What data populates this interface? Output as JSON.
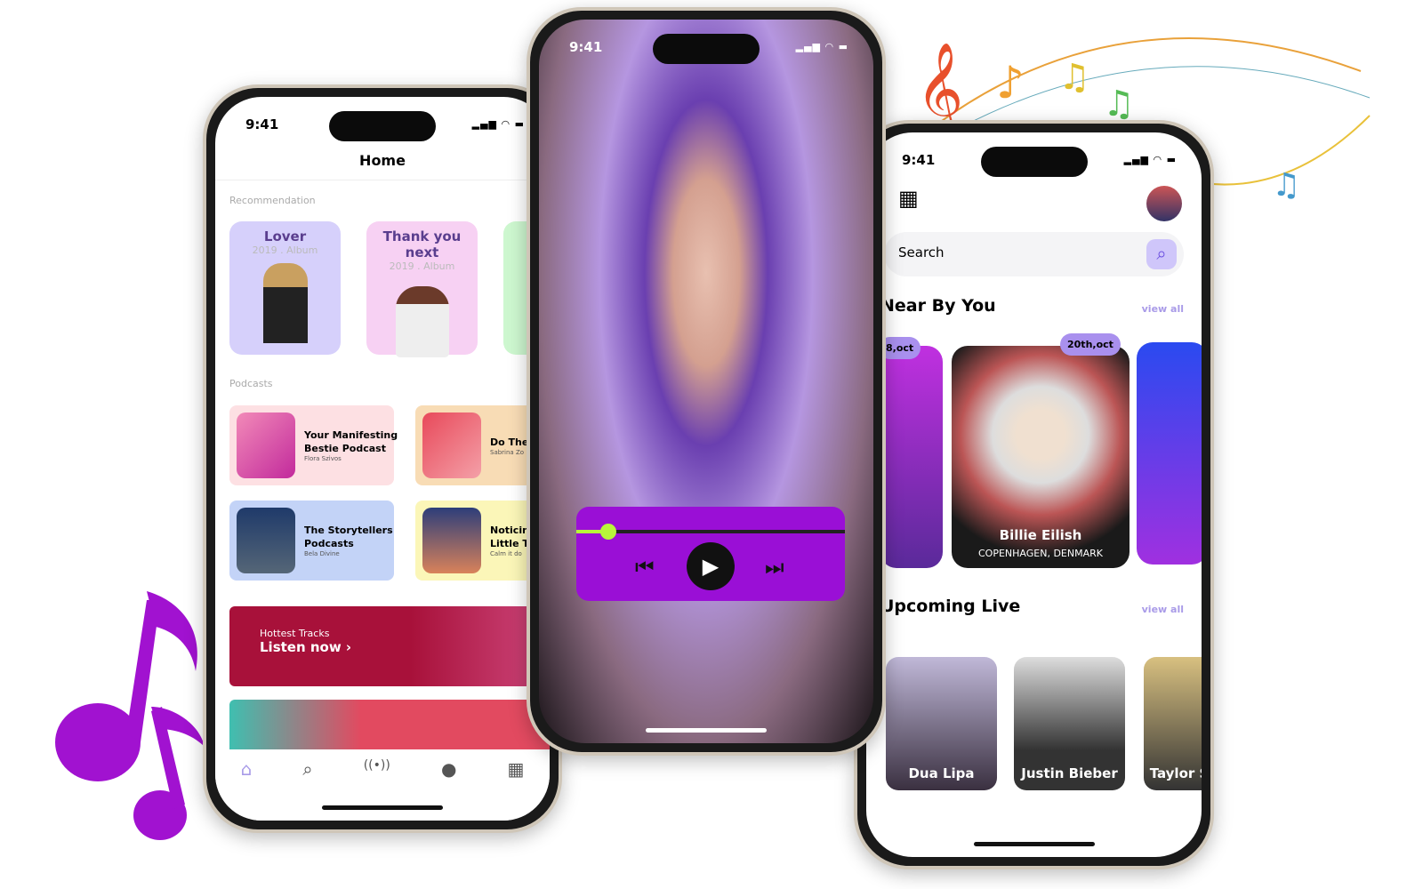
{
  "left_phone": {
    "time": "9:41",
    "title": "Home",
    "recommendation_label": "Recommendation",
    "recommendations": [
      {
        "title": "Lover",
        "subtitle": "2019 . Album"
      },
      {
        "title": "Thank you next",
        "subtitle": "2019 . Album"
      }
    ],
    "podcasts_label": "Podcasts",
    "podcasts": [
      {
        "title": "Your Manifesting",
        "title2": "Bestie Podcast",
        "author": "Flora Szivos"
      },
      {
        "title": "Do The",
        "title2": "",
        "author": "Sabrina Zo"
      },
      {
        "title": "The Storytellers",
        "title2": "Podcasts",
        "author": "Bela Divine"
      },
      {
        "title": "Noticin",
        "title2": "Little T",
        "author": "Calm it do"
      }
    ],
    "banner": {
      "label": "Hottest Tracks",
      "cta": "Listen now ›"
    },
    "nav": [
      "home-icon",
      "search-icon",
      "broadcast-icon",
      "profile-icon",
      "calendar-icon"
    ]
  },
  "middle_phone": {
    "time": "9:41",
    "progress_percent": 12,
    "accent": "#9a0fd6"
  },
  "right_phone": {
    "time": "9:41",
    "search_placeholder": "Search",
    "near_title": "Near By You",
    "view_all": "view all",
    "near": [
      {
        "date": "8,oct"
      },
      {
        "date": "20th,oct",
        "name": "Billie Eilish",
        "location": "COPENHAGEN, DENMARK"
      }
    ],
    "upcoming_title": "Upcoming Live",
    "upcoming": [
      "Dua Lipa",
      "Justin Bieber",
      "Taylor S"
    ]
  }
}
